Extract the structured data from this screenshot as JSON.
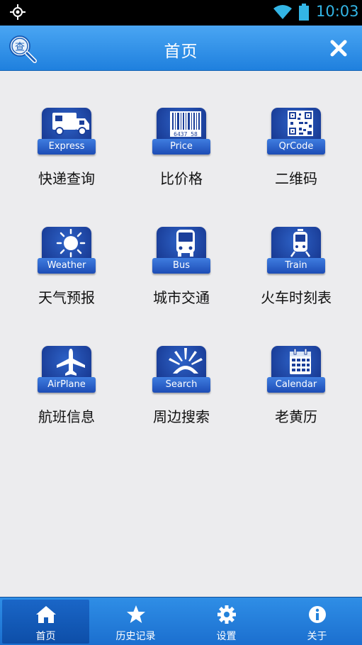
{
  "status_bar": {
    "time": "10:03"
  },
  "header": {
    "title": "首页"
  },
  "tiles": [
    {
      "badge": "Express",
      "label": "快递查询",
      "icon": "truck-icon"
    },
    {
      "badge": "Price",
      "label": "比价格",
      "icon": "barcode-icon",
      "barcode_digits": "6437 58"
    },
    {
      "badge": "QrCode",
      "label": "二维码",
      "icon": "qrcode-icon"
    },
    {
      "badge": "Weather",
      "label": "天气预报",
      "icon": "sun-icon"
    },
    {
      "badge": "Bus",
      "label": "城市交通",
      "icon": "bus-icon"
    },
    {
      "badge": "Train",
      "label": "火车时刻表",
      "icon": "train-icon"
    },
    {
      "badge": "AirPlane",
      "label": "航班信息",
      "icon": "airplane-icon"
    },
    {
      "badge": "Search",
      "label": "周边搜索",
      "icon": "radar-icon"
    },
    {
      "badge": "Calendar",
      "label": "老黄历",
      "icon": "calendar-icon"
    }
  ],
  "bottom_nav": [
    {
      "label": "首页",
      "icon": "home-icon",
      "active": true
    },
    {
      "label": "历史记录",
      "icon": "star-icon",
      "active": false
    },
    {
      "label": "设置",
      "icon": "gear-icon",
      "active": false
    },
    {
      "label": "关于",
      "icon": "info-icon",
      "active": false
    }
  ],
  "colors": {
    "accent": "#33b5e5",
    "header_blue": "#2a8be6",
    "tile_blue": "#1b3f9a"
  }
}
